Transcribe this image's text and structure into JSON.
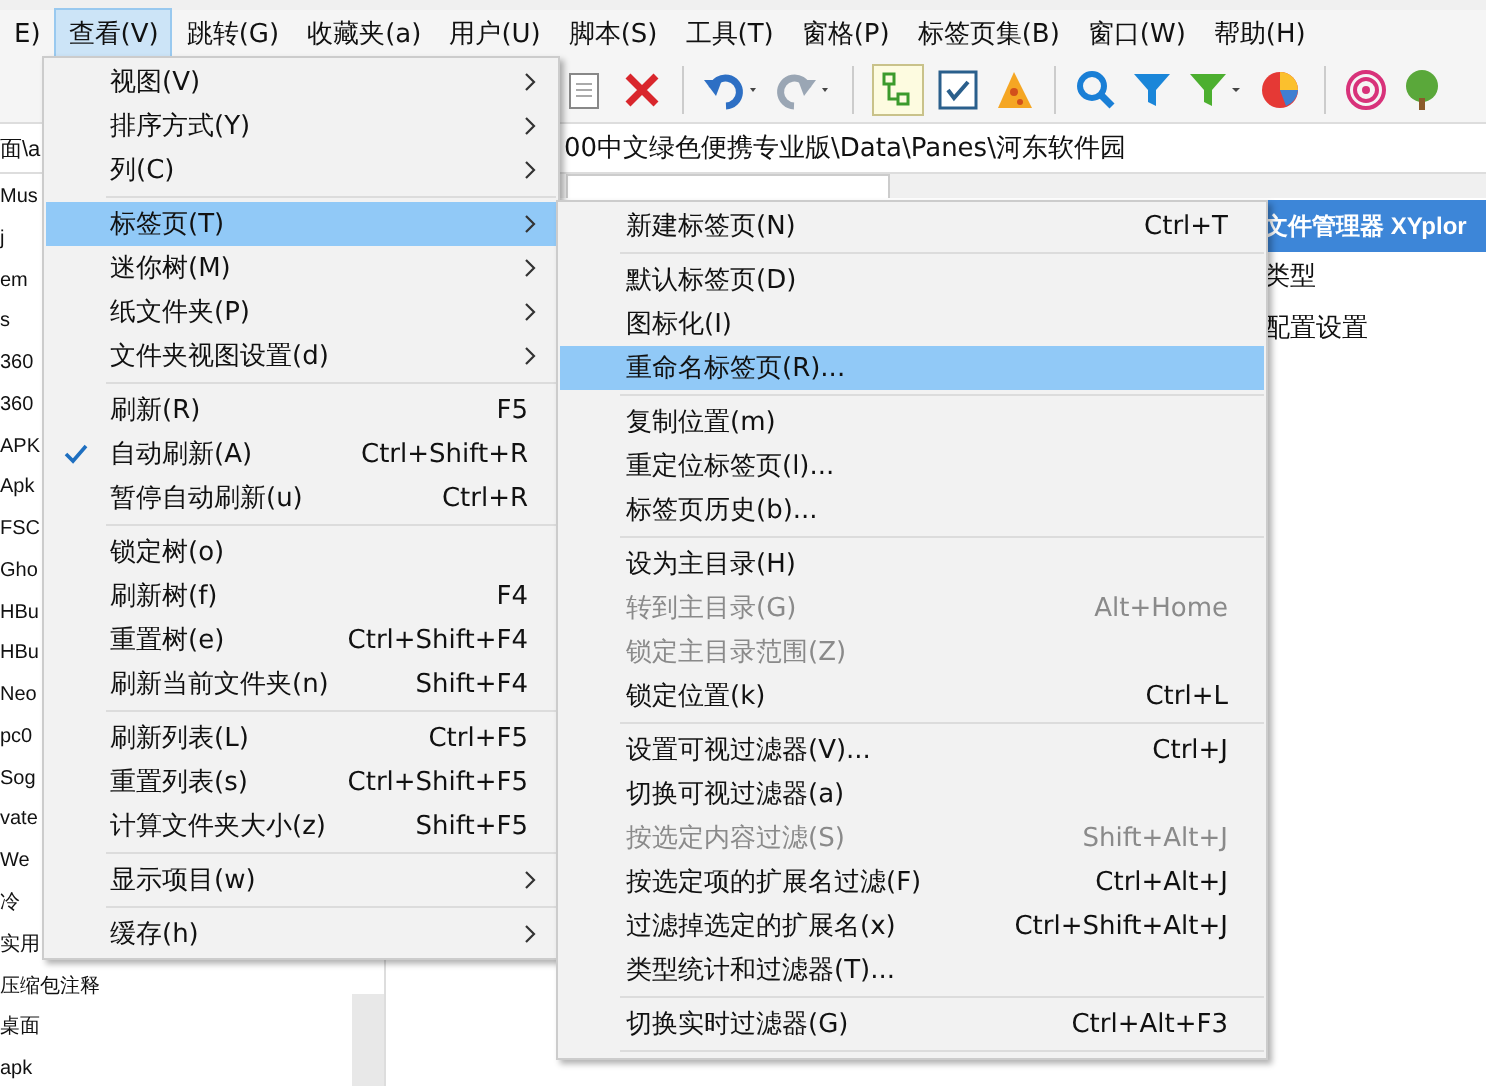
{
  "menubar": [
    {
      "label": "E)",
      "selected": false
    },
    {
      "label": "查看(V)",
      "selected": true
    },
    {
      "label": "跳转(G)",
      "selected": false
    },
    {
      "label": "收藏夹(a)",
      "selected": false
    },
    {
      "label": "用户(U)",
      "selected": false
    },
    {
      "label": "脚本(S)",
      "selected": false
    },
    {
      "label": "工具(T)",
      "selected": false
    },
    {
      "label": "窗格(P)",
      "selected": false
    },
    {
      "label": "标签页集(B)",
      "selected": false
    },
    {
      "label": "窗口(W)",
      "selected": false
    },
    {
      "label": "帮助(H)",
      "selected": false
    }
  ],
  "address_bar": {
    "left_text": "面\\a",
    "path": "00中文绿色便携专业版\\Data\\Panes\\河东软件园"
  },
  "tree": [
    "Mus",
    "j",
    "em",
    "s",
    "360",
    "360",
    "APK",
    "Apk",
    "FSC",
    "Gho",
    "HBu",
    "HBu",
    "Neo",
    "pc0",
    "Sog",
    "vate",
    "We",
    "冷",
    "实用",
    "压缩包注释",
    "桌面",
    "apk"
  ],
  "file_list": [
    {
      "label": "文件管理器 XYplor",
      "selected": true
    },
    {
      "label": "类型",
      "selected": false
    },
    {
      "label": "配置设置",
      "selected": false
    }
  ],
  "view_menu": [
    {
      "kind": "item",
      "label": "视图(V)",
      "submenu": true,
      "checked": false,
      "selected": false,
      "disabled": false
    },
    {
      "kind": "item",
      "label": "排序方式(Y)",
      "submenu": true,
      "checked": false,
      "selected": false,
      "disabled": false
    },
    {
      "kind": "item",
      "label": "列(C)",
      "submenu": true,
      "checked": false,
      "selected": false,
      "disabled": false
    },
    {
      "kind": "separator"
    },
    {
      "kind": "item",
      "label": "标签页(T)",
      "submenu": true,
      "checked": false,
      "selected": true,
      "disabled": false
    },
    {
      "kind": "item",
      "label": "迷你树(M)",
      "submenu": true,
      "checked": false,
      "selected": false,
      "disabled": false
    },
    {
      "kind": "item",
      "label": "纸文件夹(P)",
      "submenu": true,
      "checked": false,
      "selected": false,
      "disabled": false
    },
    {
      "kind": "item",
      "label": "文件夹视图设置(d)",
      "submenu": true,
      "checked": false,
      "selected": false,
      "disabled": false
    },
    {
      "kind": "separator"
    },
    {
      "kind": "item",
      "label": "刷新(R)",
      "shortcut": "F5",
      "submenu": false,
      "checked": false,
      "selected": false,
      "disabled": false
    },
    {
      "kind": "item",
      "label": "自动刷新(A)",
      "shortcut": "Ctrl+Shift+R",
      "submenu": false,
      "checked": true,
      "selected": false,
      "disabled": false
    },
    {
      "kind": "item",
      "label": "暂停自动刷新(u)",
      "shortcut": "Ctrl+R",
      "submenu": false,
      "checked": false,
      "selected": false,
      "disabled": false
    },
    {
      "kind": "separator"
    },
    {
      "kind": "item",
      "label": "锁定树(o)",
      "submenu": false,
      "checked": false,
      "selected": false,
      "disabled": false
    },
    {
      "kind": "item",
      "label": "刷新树(f)",
      "shortcut": "F4",
      "submenu": false,
      "checked": false,
      "selected": false,
      "disabled": false
    },
    {
      "kind": "item",
      "label": "重置树(e)",
      "shortcut": "Ctrl+Shift+F4",
      "submenu": false,
      "checked": false,
      "selected": false,
      "disabled": false
    },
    {
      "kind": "item",
      "label": "刷新当前文件夹(n)",
      "shortcut": "Shift+F4",
      "submenu": false,
      "checked": false,
      "selected": false,
      "disabled": false
    },
    {
      "kind": "separator"
    },
    {
      "kind": "item",
      "label": "刷新列表(L)",
      "shortcut": "Ctrl+F5",
      "submenu": false,
      "checked": false,
      "selected": false,
      "disabled": false
    },
    {
      "kind": "item",
      "label": "重置列表(s)",
      "shortcut": "Ctrl+Shift+F5",
      "submenu": false,
      "checked": false,
      "selected": false,
      "disabled": false
    },
    {
      "kind": "item",
      "label": "计算文件夹大小(z)",
      "shortcut": "Shift+F5",
      "submenu": false,
      "checked": false,
      "selected": false,
      "disabled": false
    },
    {
      "kind": "separator"
    },
    {
      "kind": "item",
      "label": "显示项目(w)",
      "submenu": true,
      "checked": false,
      "selected": false,
      "disabled": false
    },
    {
      "kind": "separator"
    },
    {
      "kind": "item",
      "label": "缓存(h)",
      "submenu": true,
      "checked": false,
      "selected": false,
      "disabled": false
    }
  ],
  "tab_submenu": [
    {
      "kind": "item",
      "label": "新建标签页(N)",
      "shortcut": "Ctrl+T",
      "selected": false,
      "disabled": false
    },
    {
      "kind": "separator"
    },
    {
      "kind": "item",
      "label": "默认标签页(D)",
      "selected": false,
      "disabled": false
    },
    {
      "kind": "item",
      "label": "图标化(I)",
      "selected": false,
      "disabled": false
    },
    {
      "kind": "item",
      "label": "重命名标签页(R)...",
      "selected": true,
      "disabled": false
    },
    {
      "kind": "separator"
    },
    {
      "kind": "item",
      "label": "复制位置(m)",
      "selected": false,
      "disabled": false
    },
    {
      "kind": "item",
      "label": "重定位标签页(l)...",
      "selected": false,
      "disabled": false
    },
    {
      "kind": "item",
      "label": "标签页历史(b)...",
      "selected": false,
      "disabled": false
    },
    {
      "kind": "separator"
    },
    {
      "kind": "item",
      "label": "设为主目录(H)",
      "selected": false,
      "disabled": false
    },
    {
      "kind": "item",
      "label": "转到主目录(G)",
      "shortcut": "Alt+Home",
      "selected": false,
      "disabled": true
    },
    {
      "kind": "item",
      "label": "锁定主目录范围(Z)",
      "selected": false,
      "disabled": true
    },
    {
      "kind": "item",
      "label": "锁定位置(k)",
      "shortcut": "Ctrl+L",
      "selected": false,
      "disabled": false
    },
    {
      "kind": "separator"
    },
    {
      "kind": "item",
      "label": "设置可视过滤器(V)...",
      "shortcut": "Ctrl+J",
      "selected": false,
      "disabled": false
    },
    {
      "kind": "item",
      "label": "切换可视过滤器(a)",
      "selected": false,
      "disabled": false
    },
    {
      "kind": "item",
      "label": "按选定内容过滤(S)",
      "shortcut": "Shift+Alt+J",
      "selected": false,
      "disabled": true
    },
    {
      "kind": "item",
      "label": "按选定项的扩展名过滤(F)",
      "shortcut": "Ctrl+Alt+J",
      "selected": false,
      "disabled": false
    },
    {
      "kind": "item",
      "label": "过滤掉选定的扩展名(x)",
      "shortcut": "Ctrl+Shift+Alt+J",
      "selected": false,
      "disabled": false
    },
    {
      "kind": "item",
      "label": "类型统计和过滤器(T)...",
      "selected": false,
      "disabled": false
    },
    {
      "kind": "separator"
    },
    {
      "kind": "item",
      "label": "切换实时过滤器(G)",
      "shortcut": "Ctrl+Alt+F3",
      "selected": false,
      "disabled": false
    },
    {
      "kind": "separator"
    }
  ]
}
